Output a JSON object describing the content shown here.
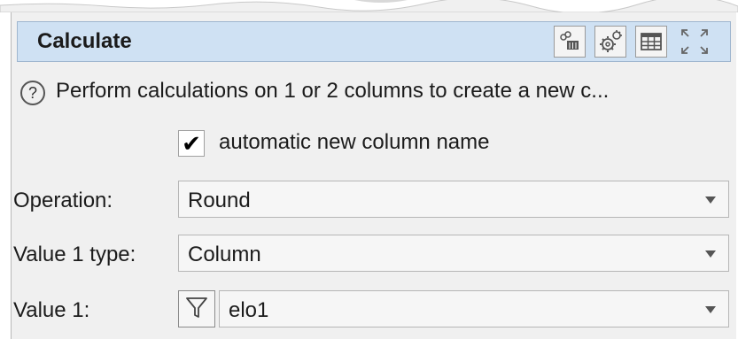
{
  "panel": {
    "title": "Calculate",
    "help_text": "Perform calculations on 1 or 2 columns to create a new c...",
    "auto_name_label": "automatic new column name",
    "auto_name_checked": true,
    "check_mark": "✔",
    "help_glyph": "?"
  },
  "form": {
    "operation": {
      "label": "Operation:",
      "value": "Round"
    },
    "value1_type": {
      "label": "Value 1 type:",
      "value": "Column"
    },
    "value1": {
      "label": "Value 1:",
      "value": "elo1"
    }
  },
  "header_buttons": [
    "link-table-icon",
    "settings-icon",
    "table-icon",
    "maximize-icon"
  ]
}
